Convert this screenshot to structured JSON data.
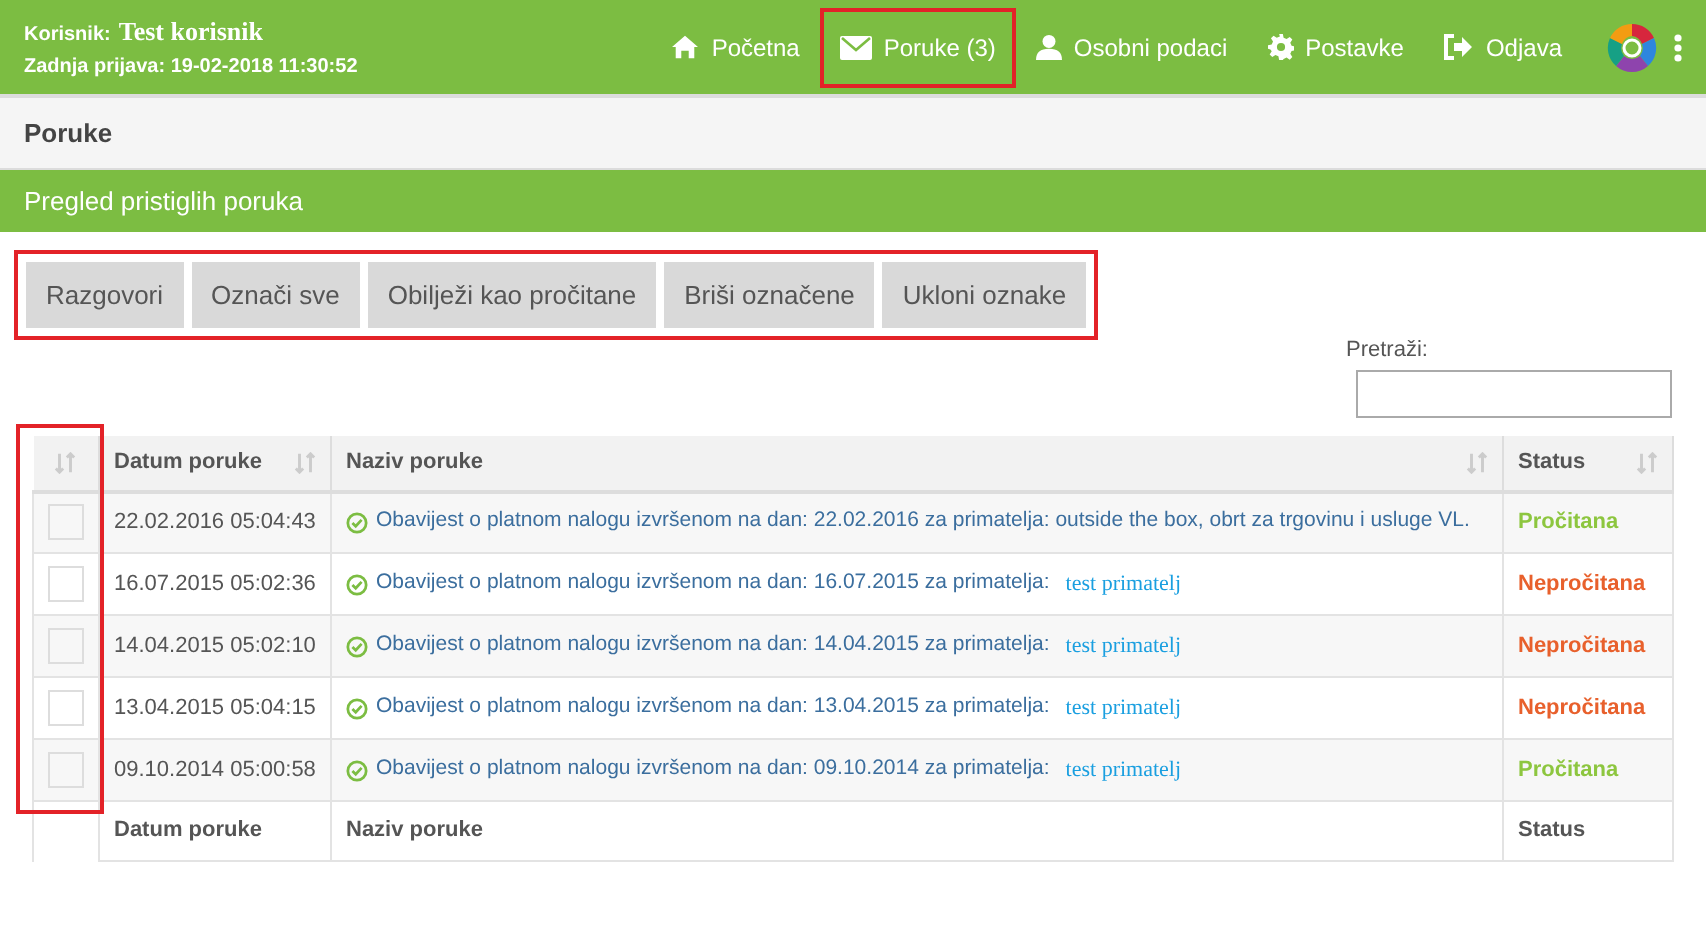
{
  "user": {
    "label": "Korisnik:",
    "name": "Test korisnik",
    "last_login": "Zadnja prijava: 19-02-2018 11:30:52"
  },
  "nav": [
    {
      "kind": "home",
      "label": "Početna",
      "highlighted": false
    },
    {
      "kind": "mail",
      "label": "Poruke (3)",
      "highlighted": true
    },
    {
      "kind": "user",
      "label": "Osobni podaci",
      "highlighted": false
    },
    {
      "kind": "gear",
      "label": "Postavke",
      "highlighted": false
    },
    {
      "kind": "logout",
      "label": "Odjava",
      "highlighted": false
    }
  ],
  "breadcrumb": "Poruke",
  "section_title": "Pregled pristiglih poruka",
  "toolbar": {
    "highlighted": true,
    "buttons": [
      "Razgovori",
      "Označi sve",
      "Obilježi kao pročitane",
      "Briši označene",
      "Ukloni oznake"
    ]
  },
  "search": {
    "label": "Pretraži:"
  },
  "table": {
    "checkbox_column_highlighted": true,
    "columns": [
      "Datum poruke",
      "Naziv poruke",
      "Status"
    ],
    "rows": [
      {
        "checked": false,
        "date": "22.02.2016 05:04:43",
        "message": "Obavijest o platnom nalogu izvršenom na dan: 22.02.2016 za primatelja: outside the box, obrt za trgovinu i usluge VL.",
        "status": "Pročitana",
        "read": true
      },
      {
        "checked": false,
        "date": "16.07.2015 05:02:36",
        "message": "Obavijest o platnom nalogu izvršenom na dan: 16.07.2015 za primatelja:",
        "link": "test primatelj",
        "status": "Nepročitana",
        "read": false
      },
      {
        "checked": false,
        "date": "14.04.2015 05:02:10",
        "message": "Obavijest o platnom nalogu izvršenom na dan: 14.04.2015 za primatelja:",
        "link": "test primatelj",
        "status": "Nepročitana",
        "read": false
      },
      {
        "checked": false,
        "date": "13.04.2015 05:04:15",
        "message": "Obavijest o platnom nalogu izvršenom na dan: 13.04.2015 za primatelja:",
        "link": "test primatelj",
        "status": "Nepročitana",
        "read": false
      },
      {
        "checked": false,
        "date": "09.10.2014 05:00:58",
        "message": "Obavijest o platnom nalogu izvršenom na dan: 09.10.2014 za primatelja:",
        "link": "test primatelj",
        "status": "Pročitana",
        "read": true
      }
    ],
    "footer": [
      "Datum poruke",
      "Naziv poruke",
      "Status"
    ]
  }
}
